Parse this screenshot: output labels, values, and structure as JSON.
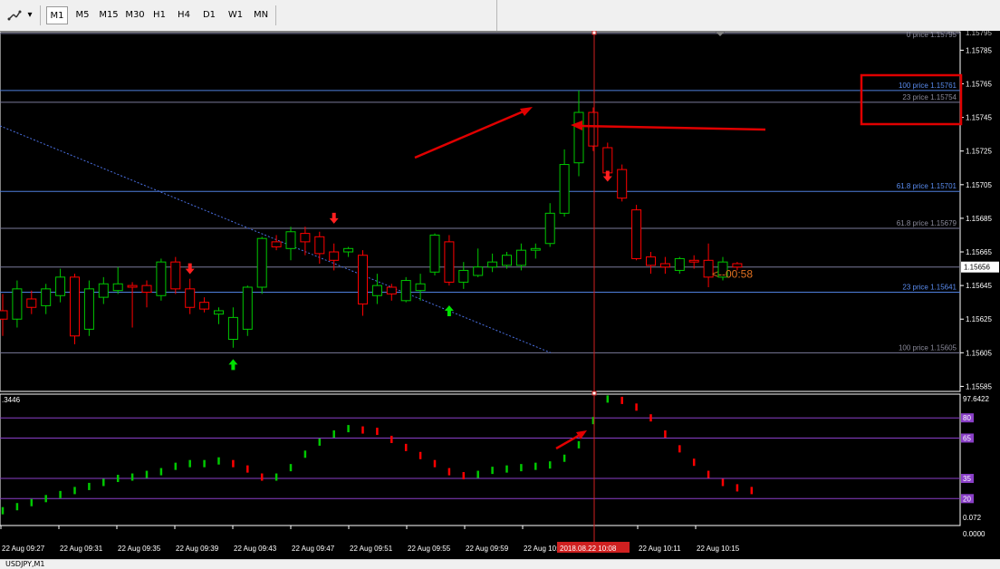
{
  "toolbar": {
    "tool_icon": "crosshair-tools-icon",
    "dropdown_icon": "chevron-down-icon",
    "timeframes": [
      "M1",
      "M5",
      "M15",
      "M30",
      "H1",
      "H4",
      "D1",
      "W1",
      "MN"
    ],
    "active_timeframe": "M1"
  },
  "price_axis": {
    "ticks": [
      1.15785,
      1.15765,
      1.15745,
      1.15725,
      1.15705,
      1.15685,
      1.15665,
      1.15645,
      1.15625,
      1.15605,
      1.15585
    ],
    "top_cut_label": "1.15795",
    "current_price_label": "1.15656"
  },
  "levels": [
    {
      "label": "100 price 1.15761",
      "price": 1.15761,
      "color": "#4f7fdc"
    },
    {
      "label": "23 price 1.15754",
      "price": 1.15754,
      "color": "#7a7a9a"
    },
    {
      "label": "61.8 price 1.15701",
      "price": 1.15701,
      "color": "#4f7fdc"
    },
    {
      "label": "61.8 price 1.15679",
      "price": 1.15679,
      "color": "#7a7a9a"
    },
    {
      "label": "23 price 1.15641",
      "price": 1.15641,
      "color": "#4f7fdc"
    },
    {
      "label": "100 price 1.15605",
      "price": 1.15605,
      "color": "#7a7a9a"
    }
  ],
  "top_level_label": "0 price 1.15795",
  "countdown_label": "<--00:58",
  "candles": [
    {
      "o": 1.1563,
      "h": 1.1564,
      "l": 1.15615,
      "c": 1.15625
    },
    {
      "o": 1.15625,
      "h": 1.15648,
      "l": 1.1562,
      "c": 1.15643
    },
    {
      "o": 1.15637,
      "h": 1.15642,
      "l": 1.15628,
      "c": 1.15632
    },
    {
      "o": 1.15633,
      "h": 1.15646,
      "l": 1.15628,
      "c": 1.15643
    },
    {
      "o": 1.15639,
      "h": 1.15655,
      "l": 1.15635,
      "c": 1.1565
    },
    {
      "o": 1.1565,
      "h": 1.15652,
      "l": 1.1561,
      "c": 1.15615
    },
    {
      "o": 1.15619,
      "h": 1.15648,
      "l": 1.15615,
      "c": 1.15643
    },
    {
      "o": 1.15638,
      "h": 1.1565,
      "l": 1.15634,
      "c": 1.15646
    },
    {
      "o": 1.15642,
      "h": 1.15656,
      "l": 1.1564,
      "c": 1.15646
    },
    {
      "o": 1.15645,
      "h": 1.15647,
      "l": 1.1562,
      "c": 1.15644
    },
    {
      "o": 1.15645,
      "h": 1.15648,
      "l": 1.15632,
      "c": 1.15641
    },
    {
      "o": 1.15639,
      "h": 1.15661,
      "l": 1.15636,
      "c": 1.15659
    },
    {
      "o": 1.15659,
      "h": 1.15662,
      "l": 1.1564,
      "c": 1.15643
    },
    {
      "o": 1.15643,
      "h": 1.15649,
      "l": 1.15628,
      "c": 1.15632
    },
    {
      "o": 1.15635,
      "h": 1.15638,
      "l": 1.15629,
      "c": 1.15631
    },
    {
      "o": 1.15628,
      "h": 1.15632,
      "l": 1.15622,
      "c": 1.1563
    },
    {
      "o": 1.15613,
      "h": 1.15632,
      "l": 1.15608,
      "c": 1.15626
    },
    {
      "o": 1.15619,
      "h": 1.15645,
      "l": 1.15615,
      "c": 1.15644
    },
    {
      "o": 1.15644,
      "h": 1.15674,
      "l": 1.1564,
      "c": 1.15673
    },
    {
      "o": 1.15671,
      "h": 1.15675,
      "l": 1.15666,
      "c": 1.15668
    },
    {
      "o": 1.15667,
      "h": 1.1568,
      "l": 1.1566,
      "c": 1.15677
    },
    {
      "o": 1.15676,
      "h": 1.1568,
      "l": 1.15663,
      "c": 1.15671
    },
    {
      "o": 1.15674,
      "h": 1.15677,
      "l": 1.15658,
      "c": 1.15664
    },
    {
      "o": 1.15665,
      "h": 1.1567,
      "l": 1.15654,
      "c": 1.1566
    },
    {
      "o": 1.15665,
      "h": 1.15668,
      "l": 1.15662,
      "c": 1.15667
    },
    {
      "o": 1.15663,
      "h": 1.15666,
      "l": 1.15627,
      "c": 1.15634
    },
    {
      "o": 1.15639,
      "h": 1.15652,
      "l": 1.15634,
      "c": 1.15645
    },
    {
      "o": 1.15644,
      "h": 1.15646,
      "l": 1.15636,
      "c": 1.1564
    },
    {
      "o": 1.15636,
      "h": 1.1565,
      "l": 1.15635,
      "c": 1.15648
    },
    {
      "o": 1.15642,
      "h": 1.15652,
      "l": 1.15636,
      "c": 1.15646
    },
    {
      "o": 1.15653,
      "h": 1.15676,
      "l": 1.15651,
      "c": 1.15675
    },
    {
      "o": 1.15671,
      "h": 1.15675,
      "l": 1.15645,
      "c": 1.15647
    },
    {
      "o": 1.15647,
      "h": 1.15659,
      "l": 1.15643,
      "c": 1.15654
    },
    {
      "o": 1.15651,
      "h": 1.15667,
      "l": 1.1565,
      "c": 1.15656
    },
    {
      "o": 1.15656,
      "h": 1.15664,
      "l": 1.15653,
      "c": 1.15659
    },
    {
      "o": 1.15657,
      "h": 1.15665,
      "l": 1.15655,
      "c": 1.15663
    },
    {
      "o": 1.15657,
      "h": 1.1567,
      "l": 1.15654,
      "c": 1.15666
    },
    {
      "o": 1.15666,
      "h": 1.1567,
      "l": 1.15661,
      "c": 1.15667
    },
    {
      "o": 1.1567,
      "h": 1.15694,
      "l": 1.15668,
      "c": 1.15688
    },
    {
      "o": 1.15688,
      "h": 1.15726,
      "l": 1.15686,
      "c": 1.15717
    },
    {
      "o": 1.15718,
      "h": 1.15761,
      "l": 1.1571,
      "c": 1.15748
    },
    {
      "o": 1.15748,
      "h": 1.15751,
      "l": 1.15725,
      "c": 1.15728
    },
    {
      "o": 1.15727,
      "h": 1.1573,
      "l": 1.1571,
      "c": 1.15712
    },
    {
      "o": 1.15714,
      "h": 1.15717,
      "l": 1.15695,
      "c": 1.15697
    },
    {
      "o": 1.1569,
      "h": 1.15693,
      "l": 1.1566,
      "c": 1.15661
    },
    {
      "o": 1.15662,
      "h": 1.15665,
      "l": 1.15652,
      "c": 1.15657
    },
    {
      "o": 1.15658,
      "h": 1.15662,
      "l": 1.15652,
      "c": 1.15656
    },
    {
      "o": 1.15654,
      "h": 1.15662,
      "l": 1.15652,
      "c": 1.15661
    },
    {
      "o": 1.1566,
      "h": 1.15663,
      "l": 1.15655,
      "c": 1.15659
    },
    {
      "o": 1.1566,
      "h": 1.1567,
      "l": 1.15644,
      "c": 1.1565
    },
    {
      "o": 1.1565,
      "h": 1.15662,
      "l": 1.15648,
      "c": 1.15659
    },
    {
      "o": 1.15658,
      "h": 1.15659,
      "l": 1.15654,
      "c": 1.15656
    }
  ],
  "signals": [
    {
      "type": "up",
      "candle": 16,
      "price": 1.15598
    },
    {
      "type": "down",
      "candle": 13,
      "price": 1.15655
    },
    {
      "type": "down",
      "candle": 23,
      "price": 1.15685
    },
    {
      "type": "up",
      "candle": 31,
      "price": 1.1563
    },
    {
      "type": "down",
      "candle": 42,
      "price": 1.1571
    }
  ],
  "indicator": {
    "left_label": ".3446",
    "top_value_label": "97.6422",
    "bottom_value_label": "0.072",
    "bottom_cut_label": "0.0000",
    "levels": [
      80,
      65,
      35,
      20
    ],
    "values": [
      11,
      14,
      17,
      20,
      23,
      26,
      29,
      32,
      35,
      36,
      38,
      40,
      44,
      46,
      46,
      48,
      46,
      42,
      36,
      36,
      43,
      53,
      62,
      68,
      72,
      71,
      70,
      64,
      58,
      52,
      46,
      40,
      37,
      38,
      41,
      42,
      43,
      44,
      45,
      50,
      60,
      78,
      94,
      93,
      88,
      80,
      68,
      57,
      47,
      38,
      32,
      28,
      26
    ],
    "ylim": [
      0,
      97.6422
    ]
  },
  "time_axis": {
    "labels": [
      "22 Aug 09:27",
      "22 Aug 09:31",
      "22 Aug 09:35",
      "22 Aug 09:39",
      "22 Aug 09:43",
      "22 Aug 09:47",
      "22 Aug 09:51",
      "22 Aug 09:55",
      "22 Aug 09:59",
      "22 Aug 10:",
      "22 Aug 10:11",
      "22 Aug 10:15"
    ],
    "cursor_label": "2018.08.22 10:08"
  },
  "bottom_tab": "USDJPY,M1",
  "colors": {
    "bull": "#00c800",
    "bear": "#ff0000",
    "accent": "#e00000"
  }
}
